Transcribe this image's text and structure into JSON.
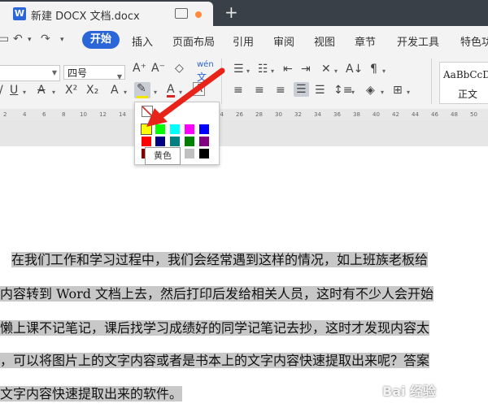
{
  "titlebar": {
    "doc_icon": "W",
    "doc_title": "新建 DOCX 文档.docx",
    "new_tab_label": "+"
  },
  "menubar": {
    "quick_icons": [
      "open-folder-icon",
      "undo-icon",
      "redo-icon"
    ],
    "tabs": [
      "开始",
      "插入",
      "页面布局",
      "引用",
      "审阅",
      "视图",
      "章节",
      "开发工具",
      "特色功能"
    ],
    "active_tab": "开始"
  },
  "ribbon": {
    "font_name": "",
    "font_size": "四号",
    "style_sample": "AaBbCcDd",
    "style_name": "正文"
  },
  "color_picker": {
    "highlight_color": "#f5e600",
    "tooltip": "黄色",
    "swatches": [
      [
        "#ffff00",
        "#00ff00",
        "#00ffff",
        "#ff00ff",
        "#0000ff"
      ],
      [
        "#ff0000",
        "#000080",
        "#008080",
        "#008000",
        "#800080"
      ],
      [
        "#800000",
        "#808000",
        "#808080",
        "#c0c0c0",
        "#000000"
      ]
    ],
    "selected": "#ffff00"
  },
  "annotation_arrow_color": "#e8231a",
  "document": {
    "lines": [
      "在我们工作和学习过程中，我们会经常遇到这样的情况，如上班族老板给",
      "内容转到 Word 文档上去，然后打印后发给相关人员，这时有不少人会开始",
      "懒上课不记笔记，课后找学习成绩好的同学记笔记去抄，这时才发现内容太",
      "，可以将图片上的文字内容或者是书本上的文字内容快速提取出来呢？答案",
      "文字内容快速提取出来的软件。"
    ]
  },
  "watermark": "Bai 经验"
}
